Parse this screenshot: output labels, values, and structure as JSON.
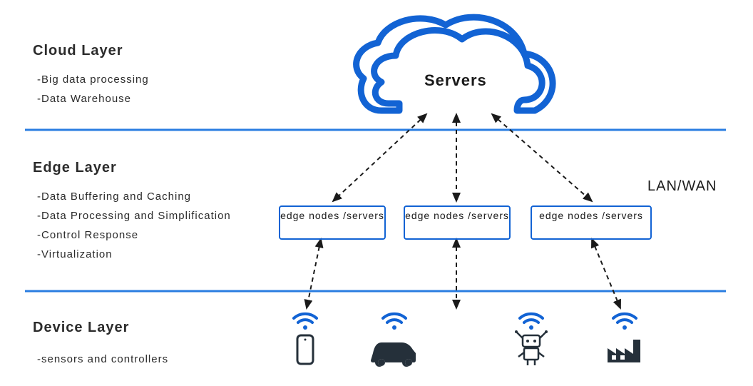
{
  "layers": {
    "cloud": {
      "title": "Cloud Layer",
      "items": [
        "-Big data processing",
        "-Data Warehouse"
      ],
      "center_label": "Servers"
    },
    "edge": {
      "title": "Edge Layer",
      "items": [
        "-Data Buffering and Caching",
        "-Data Processing and Simplification",
        "-Control Response",
        "-Virtualization"
      ],
      "network_label": "LAN/WAN",
      "nodes": [
        "edge nodes /servers",
        "edge nodes /servers",
        "edge nodes /servers"
      ]
    },
    "device": {
      "title": "Device Layer",
      "items": [
        "-sensors and controllers"
      ]
    }
  },
  "colors": {
    "accent": "#1263d4",
    "line": "#2a7de1",
    "wifi": "#1263d4",
    "icon": "#25303a"
  }
}
